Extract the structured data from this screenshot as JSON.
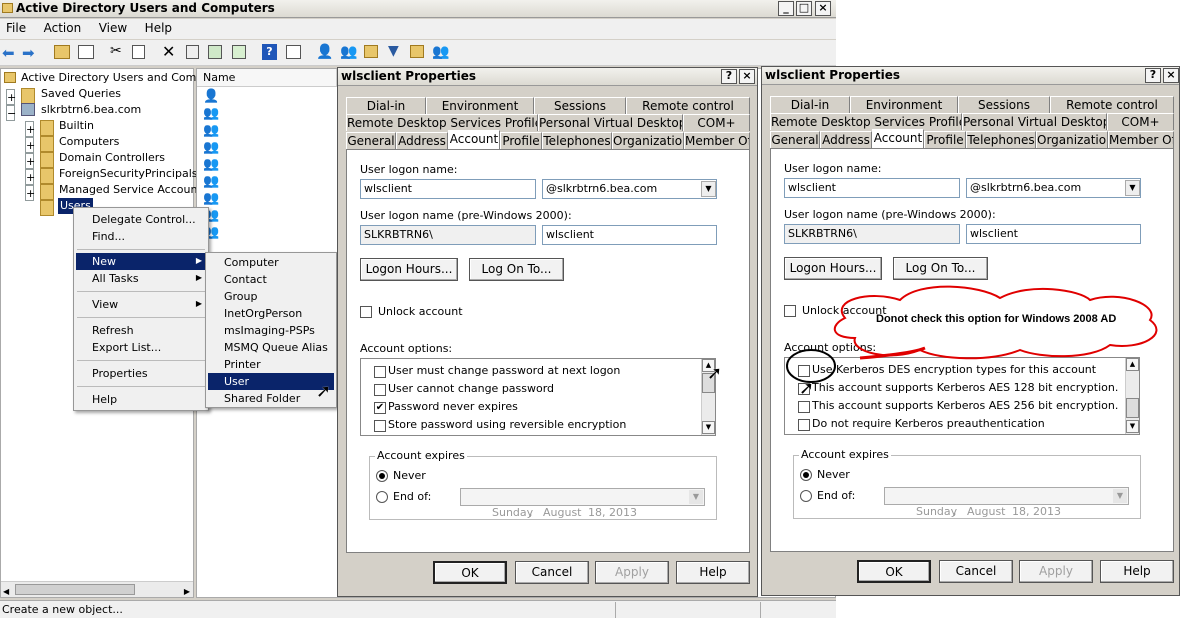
{
  "main_window": {
    "title": "Active Directory Users and Computers",
    "menu": [
      "File",
      "Action",
      "View",
      "Help"
    ],
    "status": "Create a new object..."
  },
  "tree": {
    "root": "Active Directory Users and Comput",
    "items": [
      "Saved Queries",
      "slkrbtrn6.bea.com",
      "Builtin",
      "Computers",
      "Domain Controllers",
      "ForeignSecurityPrincipals",
      "Managed Service Accounts",
      "Users"
    ]
  },
  "list": {
    "header": "Name"
  },
  "context_menu": {
    "items": [
      "Delegate Control...",
      "Find...",
      "New",
      "All Tasks",
      "View",
      "Refresh",
      "Export List...",
      "Properties",
      "Help"
    ]
  },
  "submenu": {
    "items": [
      "Computer",
      "Contact",
      "Group",
      "InetOrgPerson",
      "msImaging-PSPs",
      "MSMQ Queue Alias",
      "Printer",
      "User",
      "Shared Folder"
    ]
  },
  "dialogs": [
    {
      "title": "wlsclient Properties",
      "tabs_row1": [
        "Dial-in",
        "Environment",
        "Sessions",
        "Remote control"
      ],
      "tabs_row2": [
        "Remote Desktop Services Profile",
        "Personal Virtual Desktop",
        "COM+"
      ],
      "tabs_row3": [
        "General",
        "Address",
        "Account",
        "Profile",
        "Telephones",
        "Organization",
        "Member Of"
      ],
      "logon_label": "User logon name:",
      "logon_value": "wlsclient",
      "domain_value": "@slkrbtrn6.bea.com",
      "pre2000_label": "User logon name (pre-Windows 2000):",
      "pre2000_domain": "SLKRBTRN6\\",
      "pre2000_value": "wlsclient",
      "logon_hours": "Logon Hours...",
      "log_on_to": "Log On To...",
      "unlock": "Unlock account",
      "options_label": "Account options:",
      "options": [
        {
          "text": "User must change password at next logon",
          "checked": false
        },
        {
          "text": "User cannot change password",
          "checked": false
        },
        {
          "text": "Password never expires",
          "checked": true
        },
        {
          "text": "Store password using reversible encryption",
          "checked": false
        }
      ],
      "expires_label": "Account expires",
      "never": "Never",
      "endof": "End of:",
      "date": {
        "day": "Sunday",
        "sep": ",",
        "month": "August",
        "daynum": "18, 2013"
      },
      "buttons": [
        "OK",
        "Cancel",
        "Apply",
        "Help"
      ]
    },
    {
      "title": "wlsclient Properties",
      "tabs_row1": [
        "Dial-in",
        "Environment",
        "Sessions",
        "Remote control"
      ],
      "tabs_row2": [
        "Remote Desktop Services Profile",
        "Personal Virtual Desktop",
        "COM+"
      ],
      "tabs_row3": [
        "General",
        "Address",
        "Account",
        "Profile",
        "Telephones",
        "Organization",
        "Member Of"
      ],
      "logon_label": "User logon name:",
      "logon_value": "wlsclient",
      "domain_value": "@slkrbtrn6.bea.com",
      "pre2000_label": "User logon name (pre-Windows 2000):",
      "pre2000_domain": "SLKRBTRN6\\",
      "pre2000_value": "wlsclient",
      "logon_hours": "Logon Hours...",
      "log_on_to": "Log On To...",
      "unlock": "Unlock account",
      "options_label": "Account options:",
      "options": [
        {
          "text": "Use Kerberos DES encryption types for this account",
          "checked": false
        },
        {
          "text": "This account supports Kerberos AES 128 bit encryption.",
          "checked": false
        },
        {
          "text": "This account supports Kerberos AES 256 bit encryption.",
          "checked": false
        },
        {
          "text": "Do not require Kerberos preauthentication",
          "checked": false
        }
      ],
      "expires_label": "Account expires",
      "never": "Never",
      "endof": "End of:",
      "date": {
        "day": "Sunday",
        "sep": ",",
        "month": "August",
        "daynum": "18, 2013"
      },
      "buttons": [
        "OK",
        "Cancel",
        "Apply",
        "Help"
      ]
    }
  ],
  "annotation": {
    "text": "Donot check this option for Windows 2008 AD",
    "color": "#e00000"
  }
}
